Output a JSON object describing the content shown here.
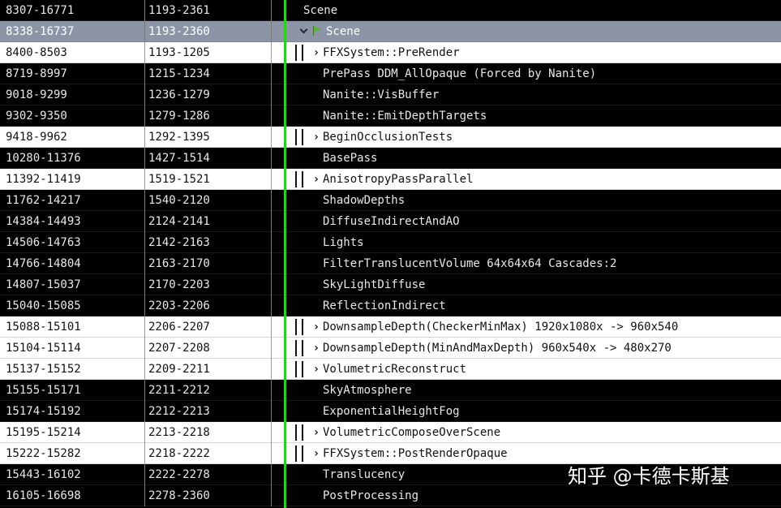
{
  "colors": {
    "selected_row": "#8b95a6",
    "light_row": "#ffffff",
    "dark_row": "#000000",
    "timeline_marker": "#2ecc24",
    "scene_flag": "#58b33a"
  },
  "rows": [
    {
      "range": "8307-16771",
      "sub": "1193-2361",
      "label": "Scene",
      "theme": "dark",
      "indent": 1,
      "marker": "none"
    },
    {
      "range": "8338-16737",
      "sub": "1193-2360",
      "label": "Scene",
      "theme": "sel",
      "indent": 2,
      "marker": "expanded-flag"
    },
    {
      "range": "8400-8503",
      "sub": "1193-1205",
      "label": "FFXSystem::PreRender",
      "theme": "light",
      "indent": 3,
      "marker": "collapsed"
    },
    {
      "range": "8719-8997",
      "sub": "1215-1234",
      "label": "PrePass DDM_AllOpaque (Forced by Nanite)",
      "theme": "dark",
      "indent": 3,
      "marker": "none"
    },
    {
      "range": "9018-9299",
      "sub": "1236-1279",
      "label": "Nanite::VisBuffer",
      "theme": "dark",
      "indent": 3,
      "marker": "none"
    },
    {
      "range": "9302-9350",
      "sub": "1279-1286",
      "label": "Nanite::EmitDepthTargets",
      "theme": "dark",
      "indent": 3,
      "marker": "none"
    },
    {
      "range": "9418-9962",
      "sub": "1292-1395",
      "label": "BeginOcclusionTests",
      "theme": "light",
      "indent": 3,
      "marker": "collapsed"
    },
    {
      "range": "10280-11376",
      "sub": "1427-1514",
      "label": "BasePass",
      "theme": "dark",
      "indent": 3,
      "marker": "none"
    },
    {
      "range": "11392-11419",
      "sub": "1519-1521",
      "label": "AnisotropyPassParallel",
      "theme": "light",
      "indent": 3,
      "marker": "collapsed"
    },
    {
      "range": "11762-14217",
      "sub": "1540-2120",
      "label": "ShadowDepths",
      "theme": "dark",
      "indent": 3,
      "marker": "none"
    },
    {
      "range": "14384-14493",
      "sub": "2124-2141",
      "label": "DiffuseIndirectAndAO",
      "theme": "dark",
      "indent": 3,
      "marker": "none"
    },
    {
      "range": "14506-14763",
      "sub": "2142-2163",
      "label": "Lights",
      "theme": "dark",
      "indent": 3,
      "marker": "none"
    },
    {
      "range": "14766-14804",
      "sub": "2163-2170",
      "label": "FilterTranslucentVolume 64x64x64 Cascades:2",
      "theme": "dark",
      "indent": 3,
      "marker": "none"
    },
    {
      "range": "14807-15037",
      "sub": "2170-2203",
      "label": "SkyLightDiffuse",
      "theme": "dark",
      "indent": 3,
      "marker": "none"
    },
    {
      "range": "15040-15085",
      "sub": "2203-2206",
      "label": "ReflectionIndirect",
      "theme": "dark",
      "indent": 3,
      "marker": "none"
    },
    {
      "range": "15088-15101",
      "sub": "2206-2207",
      "label": "DownsampleDepth(CheckerMinMax) 1920x1080x -> 960x540",
      "theme": "light",
      "indent": 3,
      "marker": "collapsed"
    },
    {
      "range": "15104-15114",
      "sub": "2207-2208",
      "label": "DownsampleDepth(MinAndMaxDepth) 960x540x -> 480x270",
      "theme": "light",
      "indent": 3,
      "marker": "collapsed"
    },
    {
      "range": "15137-15152",
      "sub": "2209-2211",
      "label": "VolumetricReconstruct",
      "theme": "light",
      "indent": 3,
      "marker": "collapsed"
    },
    {
      "range": "15155-15171",
      "sub": "2211-2212",
      "label": "SkyAtmosphere",
      "theme": "dark",
      "indent": 3,
      "marker": "none"
    },
    {
      "range": "15174-15192",
      "sub": "2212-2213",
      "label": "ExponentialHeightFog",
      "theme": "dark",
      "indent": 3,
      "marker": "none"
    },
    {
      "range": "15195-15214",
      "sub": "2213-2218",
      "label": "VolumetricComposeOverScene",
      "theme": "light",
      "indent": 3,
      "marker": "collapsed"
    },
    {
      "range": "15222-15282",
      "sub": "2218-2222",
      "label": "FFXSystem::PostRenderOpaque",
      "theme": "light",
      "indent": 3,
      "marker": "collapsed"
    },
    {
      "range": "15443-16102",
      "sub": "2222-2278",
      "label": "Translucency",
      "theme": "dark",
      "indent": 3,
      "marker": "none"
    },
    {
      "range": "16105-16698",
      "sub": "2278-2360",
      "label": "PostProcessing",
      "theme": "dark",
      "indent": 3,
      "marker": "none"
    }
  ],
  "watermark": "知乎 @卡德卡斯基"
}
